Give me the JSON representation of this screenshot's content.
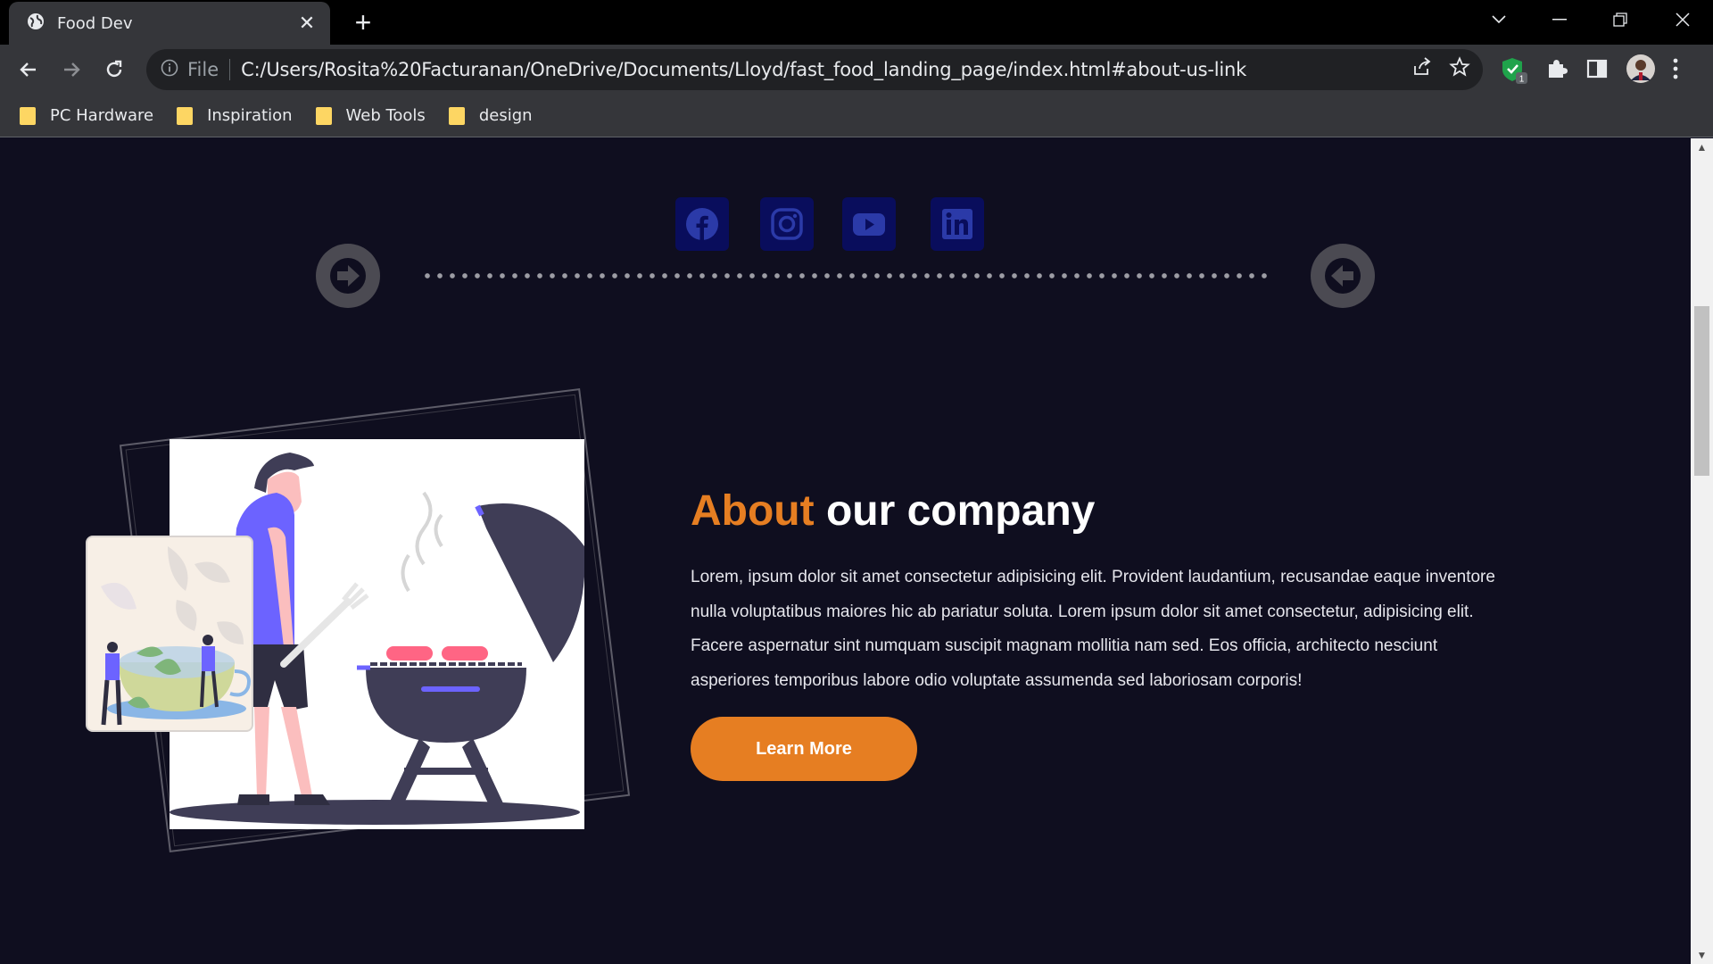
{
  "browser": {
    "tab_title": "Food Dev",
    "tab_close": "✕",
    "new_tab": "+",
    "omnibox_scheme": "File",
    "url": "C:/Users/Rosita%20Facturanan/OneDrive/Documents/Lloyd/fast_food_landing_page/index.html#about-us-link",
    "extension_badge": "1",
    "bookmarks": [
      {
        "label": "PC Hardware"
      },
      {
        "label": "Inspiration"
      },
      {
        "label": "Web Tools"
      },
      {
        "label": "design"
      }
    ]
  },
  "social": [
    "facebook-icon",
    "instagram-icon",
    "youtube-icon",
    "linkedin-icon"
  ],
  "about": {
    "title_accent": "About",
    "title_rest": " our company",
    "body": "Lorem, ipsum dolor sit amet consectetur adipisicing elit. Provident laudantium, recusandae eaque inventore nulla voluptatibus maiores hic ab pariatur soluta. Lorem ipsum dolor sit amet consectetur, adipisicing elit. Facere aspernatur sint numquam suscipit magnam mollitia nam sed. Eos officia, architecto nesciunt asperiores temporibus labore odio voluptate assumenda sed laboriosam corporis!",
    "button": "Learn More"
  },
  "colors": {
    "accent": "#e67e22",
    "page_bg": "#0f0e1f",
    "social_bg": "#090d5c",
    "social_icon": "#2b3aa8",
    "illustration_purple": "#6c63ff"
  }
}
